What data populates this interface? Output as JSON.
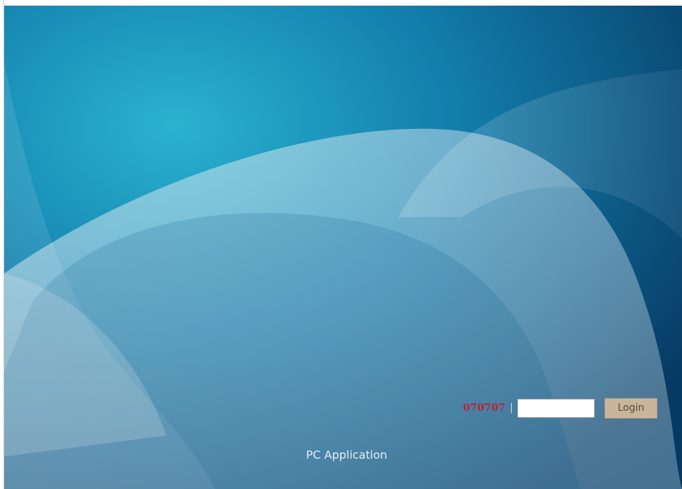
{
  "login": {
    "code_text": "070707",
    "separator": "|",
    "input_value": "",
    "button_label": "Login"
  },
  "footer": {
    "app_name": "PC Application"
  },
  "colors": {
    "code_text": "#c11d2a",
    "button_bg": "#c8b59b",
    "background_dark": "#0a3b66",
    "background_teal": "#22a3c6"
  }
}
